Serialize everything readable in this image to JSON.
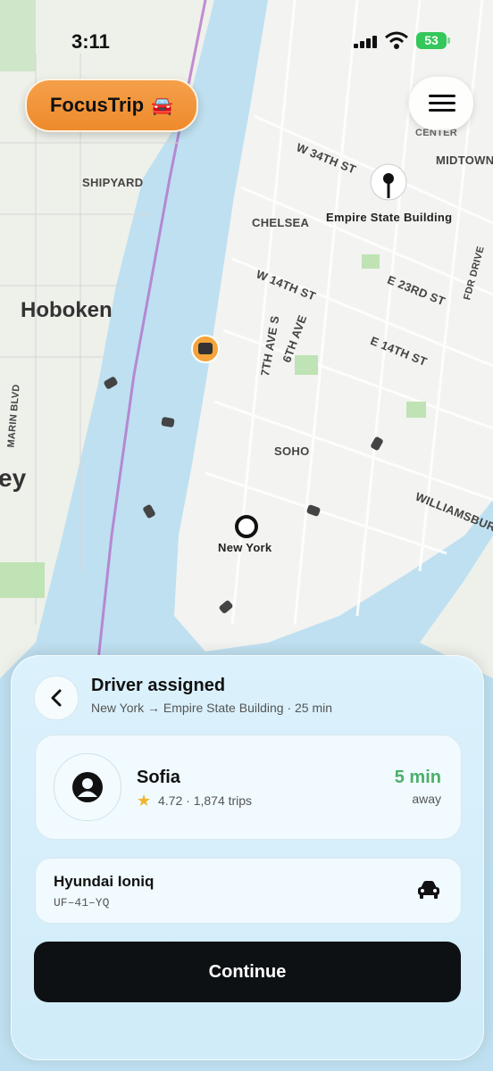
{
  "status_bar": {
    "time": "3:11",
    "battery": "53"
  },
  "app": {
    "name": "FocusTrip",
    "emoji": "🚘"
  },
  "map": {
    "labels": {
      "center": "CENTER",
      "midtown": "MIDTOWN",
      "w34": "W 34TH ST",
      "shipyard": "SHIPYARD",
      "chelsea": "CHELSEA",
      "empire": "Empire State Building",
      "hoboken": "Hoboken",
      "w14": "W 14TH ST",
      "e23": "E 23RD ST",
      "e14": "E 14TH ST",
      "ave7": "7TH AVE S",
      "ave6": "6TH AVE",
      "fdr": "FDR DRIVE",
      "marin": "MARIN BLVD",
      "soho": "SOHO",
      "williamsburg": "WILLIAMSBURG",
      "newyork": "New York",
      "jersey": "ey"
    }
  },
  "sheet": {
    "title": "Driver assigned",
    "route": "New York → Empire State Building · 25 min",
    "driver": {
      "name": "Sofia",
      "rating": "4.72 · 1,874 trips",
      "eta": "5 min",
      "away": "away"
    },
    "vehicle": {
      "model": "Hyundai Ioniq",
      "plate": "UF–41–YQ"
    },
    "continue_label": "Continue"
  }
}
